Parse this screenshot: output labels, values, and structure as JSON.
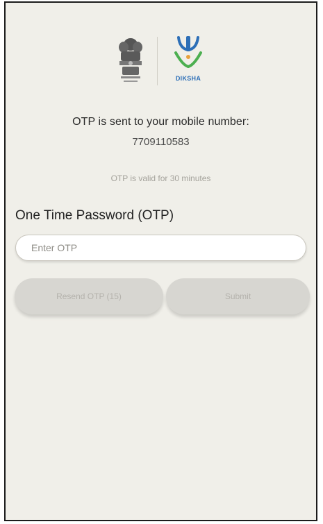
{
  "header": {
    "emblem_icon": "national-emblem-icon",
    "diksha_icon": "diksha-logo-icon",
    "diksha_label": "DIKSHA"
  },
  "otp_info": {
    "sent_message": "OTP is sent to your mobile number:",
    "phone_number": "7709110583",
    "validity_message": "OTP is valid for 30 minutes"
  },
  "form": {
    "otp_label": "One Time Password (OTP)",
    "otp_placeholder": "Enter OTP",
    "otp_value": ""
  },
  "actions": {
    "resend_label": "Resend OTP (15)",
    "submit_label": "Submit"
  },
  "colors": {
    "background": "#f0efe9",
    "diksha_blue": "#2d6fb7",
    "diksha_green": "#4caf50",
    "button_disabled": "#d7d6d1"
  }
}
